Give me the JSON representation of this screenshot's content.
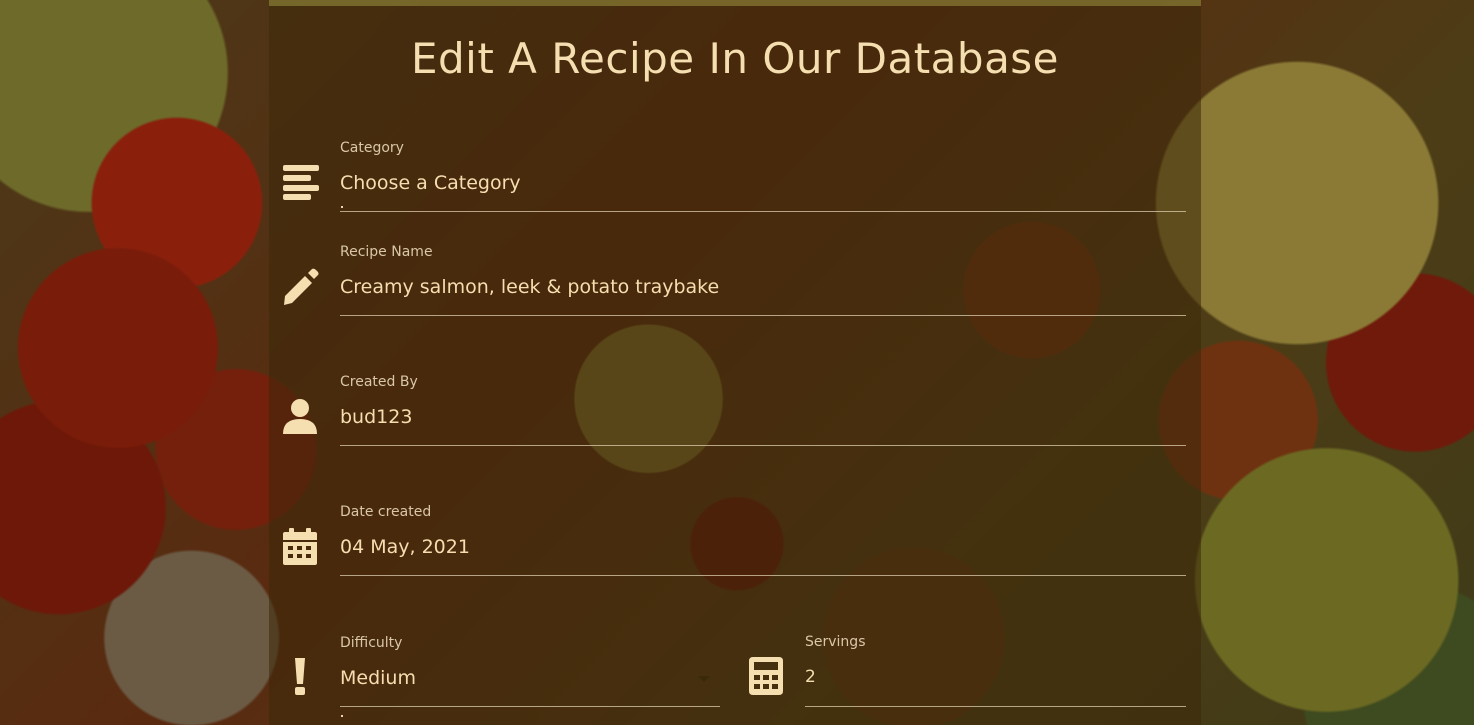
{
  "page": {
    "title": "Edit A Recipe In Our Database"
  },
  "form": {
    "category": {
      "label": "Category",
      "value": "Choose a Category",
      "icon": "list-icon"
    },
    "recipe_name": {
      "label": "Recipe Name",
      "value": "Creamy salmon, leek & potato traybake",
      "icon": "pencil-icon"
    },
    "created_by": {
      "label": "Created By",
      "value": "bud123",
      "icon": "user-icon"
    },
    "date_created": {
      "label": "Date created",
      "value": "04 May, 2021",
      "icon": "calendar-icon"
    },
    "difficulty": {
      "label": "Difficulty",
      "value": "Medium",
      "icon": "exclamation-icon"
    },
    "servings": {
      "label": "Servings",
      "value": "2",
      "icon": "calculator-icon"
    }
  },
  "colors": {
    "accent": "#f5deb0",
    "label": "#d9c7a8",
    "panel": "rgba(60, 40, 10, 0.55)"
  }
}
